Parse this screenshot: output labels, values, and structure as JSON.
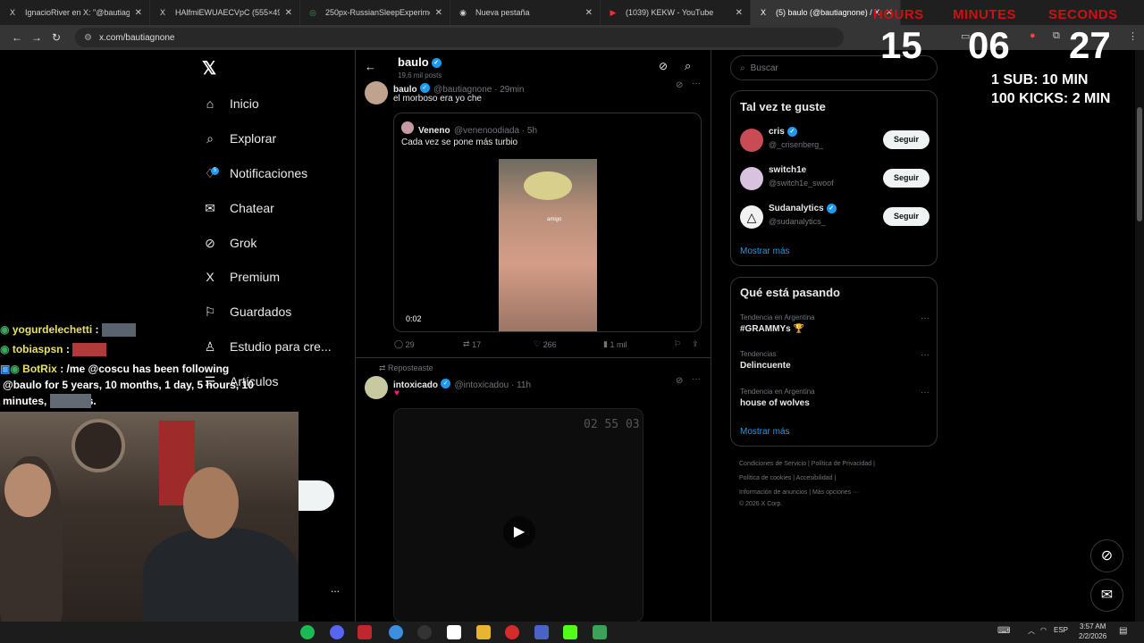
{
  "tabs": [
    {
      "title": "IgnacioRiver en X: \"@bautiagno",
      "icon": "X"
    },
    {
      "title": "HAlfmiEWUAECVpC (555×496)",
      "icon": "X"
    },
    {
      "title": "250px-RussianSleepExperiment",
      "icon": "◎"
    },
    {
      "title": "Nueva pestaña",
      "icon": "◉"
    },
    {
      "title": "(1039) KEKW - YouTube",
      "icon": "▶"
    },
    {
      "title": "(5) baulo (@bautiagnone) / X",
      "icon": "X"
    }
  ],
  "address": {
    "url": "x.com/bautiagnone"
  },
  "nav": {
    "items": [
      {
        "label": "Inicio",
        "icon": "⌂"
      },
      {
        "label": "Explorar",
        "icon": "⌕"
      },
      {
        "label": "Notificaciones",
        "icon": "♢"
      },
      {
        "label": "Chatear",
        "icon": "✉"
      },
      {
        "label": "Grok",
        "icon": "⊘"
      },
      {
        "label": "Premium",
        "icon": "X"
      },
      {
        "label": "Guardados",
        "icon": "⚐"
      },
      {
        "label": "Estudio para cre...",
        "icon": "♙"
      },
      {
        "label": "Artículos",
        "icon": "☰"
      }
    ],
    "notif_badge": "5",
    "more_dots": "..."
  },
  "profile_header": {
    "name": "baulo",
    "posts": "19,6 mil posts"
  },
  "tweet1": {
    "name": "baulo",
    "handle": "@bautiagnone · 29min",
    "text": "el morboso era yo che",
    "quote": {
      "name": "Veneno",
      "handle": "@venenoodiada · 5h",
      "text": "Cada vez se pone más turbio",
      "video_time": "0:02",
      "video_caption": "amigo"
    },
    "stats": {
      "replies": "29",
      "reposts": "17",
      "likes": "266",
      "views": "1 mil"
    }
  },
  "tweet2": {
    "repost_label": "Reposteaste",
    "name": "intoxicado",
    "handle": "@intoxicadou · 11h",
    "text": "♥",
    "video_overlay": "02 55 03"
  },
  "search": {
    "placeholder": "Buscar"
  },
  "suggestions": {
    "title": "Tal vez te guste",
    "items": [
      {
        "name": "cris",
        "handle": "@_crisenberg_",
        "button": "Seguir"
      },
      {
        "name": "switch1e",
        "handle": "@switch1e_swoof",
        "button": "Seguir"
      },
      {
        "name": "Sudanalytics",
        "handle": "@sudanalytics_",
        "button": "Seguir"
      }
    ],
    "more": "Mostrar más"
  },
  "trends": {
    "title": "Qué está pasando",
    "items": [
      {
        "context": "Tendencia en Argentina",
        "topic": "#GRAMMYs 🏆"
      },
      {
        "context": "Tendencias",
        "topic": "Delincuente"
      },
      {
        "context": "Tendencia en Argentina",
        "topic": "house of wolves"
      }
    ],
    "more": "Mostrar más"
  },
  "footer": {
    "line1": "Condiciones de Servicio  |  Política de Privacidad  |",
    "line2": "Política de cookies  |  Accesibilidad  |",
    "line3": "Información de anuncios  |  Más opciones ···",
    "line4": "© 2026 X Corp."
  },
  "overlay": {
    "hours_label": "HOURS",
    "minutes_label": "MINUTES",
    "seconds_label": "SECONDS",
    "hours": "15",
    "minutes": "06",
    "seconds": "27",
    "rule1": "1 SUB: 10 MIN",
    "rule2": "100 KICKS: 2 MIN"
  },
  "chat": [
    {
      "user": "yogurdelechetti",
      "text": ":"
    },
    {
      "user": "tobiaspsn",
      "text": ":"
    },
    {
      "user": "BotRix",
      "text": ": /me @coscu has been following"
    },
    {
      "user": "",
      "text": "@baulo for 5 years, 10 months, 1 day, 5 hours, 10"
    },
    {
      "user": "",
      "text": "minutes,          seconds."
    }
  ],
  "colors": {
    "accent": "#1d9bf0",
    "overlay_red": "#d01010"
  },
  "system": {
    "lang": "ESP",
    "time": "3:57 AM",
    "date": "2/2/2026"
  }
}
